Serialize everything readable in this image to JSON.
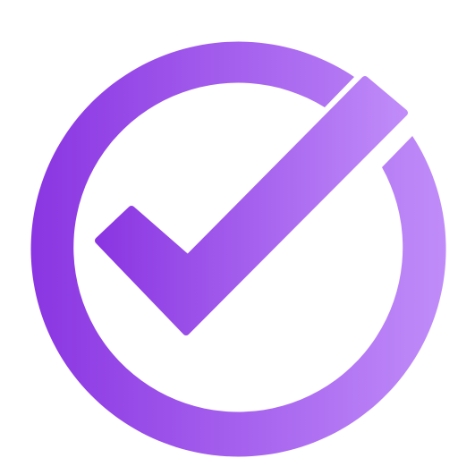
{
  "icon": {
    "name": "check-circle-icon",
    "gradient_start": "#8a35e2",
    "gradient_end": "#c08cf9",
    "background": "#ffffff"
  }
}
